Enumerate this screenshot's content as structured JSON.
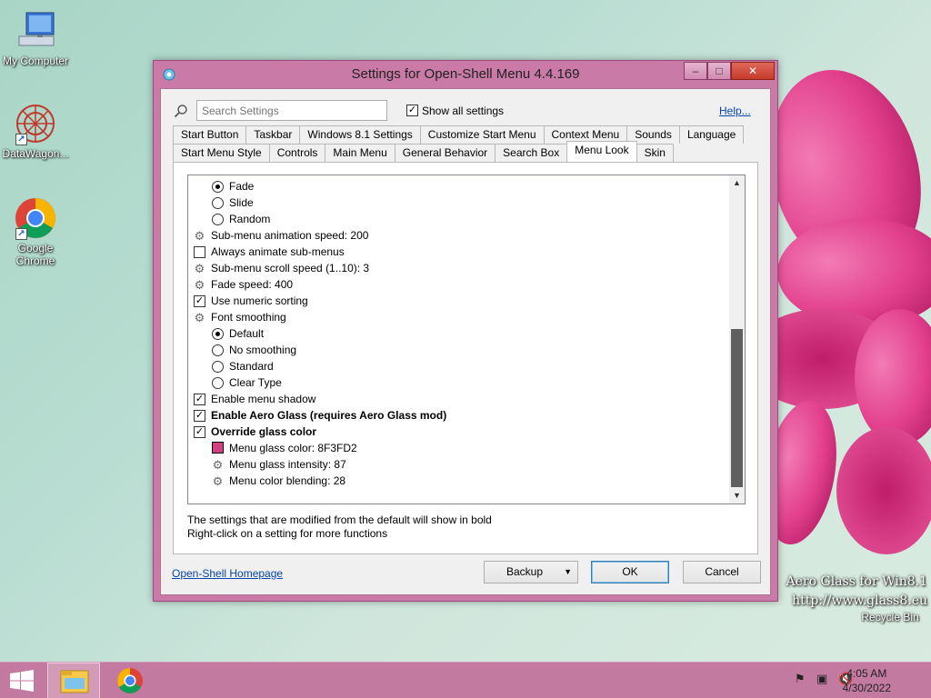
{
  "desktop": {
    "icons": [
      {
        "label": "My Computer",
        "icon": "computer-icon"
      },
      {
        "label": "DataWagon...",
        "icon": "app-icon"
      },
      {
        "label": "Google Chrome",
        "icon": "chrome-icon"
      }
    ],
    "recycle_bin": "Recycle Bin",
    "watermark_line1": "Aero Glass for Win8.1",
    "watermark_line2": "http://www.glass8.eu"
  },
  "window": {
    "title": "Settings for Open-Shell Menu 4.4.169",
    "controls": {
      "minimize": "–",
      "maximize": "□",
      "close": "✕"
    },
    "search_placeholder": "Search Settings",
    "show_all_label": "Show all settings",
    "show_all_checked": true,
    "help_label": "Help...",
    "tabs_row1": [
      "Start Button",
      "Taskbar",
      "Windows 8.1 Settings",
      "Customize Start Menu",
      "Context Menu",
      "Sounds",
      "Language"
    ],
    "tabs_row2": [
      "Start Menu Style",
      "Controls",
      "Main Menu",
      "General Behavior",
      "Search Box",
      "Menu Look",
      "Skin"
    ],
    "active_tab": "Menu Look",
    "settings": [
      {
        "kind": "radio",
        "checked": true,
        "indent": 1,
        "label": "Fade"
      },
      {
        "kind": "radio",
        "checked": false,
        "indent": 1,
        "label": "Slide"
      },
      {
        "kind": "radio",
        "checked": false,
        "indent": 1,
        "label": "Random"
      },
      {
        "kind": "gear",
        "indent": 0,
        "label": "Sub-menu animation speed: 200"
      },
      {
        "kind": "check",
        "checked": false,
        "indent": 0,
        "label": "Always animate sub-menus"
      },
      {
        "kind": "gear",
        "indent": 0,
        "label": "Sub-menu scroll speed (1..10): 3"
      },
      {
        "kind": "gear",
        "indent": 0,
        "label": "Fade speed: 400"
      },
      {
        "kind": "check",
        "checked": true,
        "indent": 0,
        "label": "Use numeric sorting"
      },
      {
        "kind": "gear",
        "indent": 0,
        "label": "Font smoothing"
      },
      {
        "kind": "radio",
        "checked": true,
        "indent": 1,
        "label": "Default"
      },
      {
        "kind": "radio",
        "checked": false,
        "indent": 1,
        "label": "No smoothing"
      },
      {
        "kind": "radio",
        "checked": false,
        "indent": 1,
        "label": "Standard"
      },
      {
        "kind": "radio",
        "checked": false,
        "indent": 1,
        "label": "Clear Type"
      },
      {
        "kind": "check",
        "checked": true,
        "indent": 0,
        "label": "Enable menu shadow"
      },
      {
        "kind": "check",
        "checked": true,
        "indent": 0,
        "bold": true,
        "label": "Enable Aero Glass (requires Aero Glass mod)"
      },
      {
        "kind": "check",
        "checked": true,
        "indent": 0,
        "bold": true,
        "label": "Override glass color"
      },
      {
        "kind": "swatch",
        "indent": 1,
        "color": "#D2407F",
        "label": "Menu glass color: 8F3FD2"
      },
      {
        "kind": "gear",
        "indent": 1,
        "label": "Menu glass intensity: 87"
      },
      {
        "kind": "gear",
        "indent": 1,
        "label": "Menu color blending: 28"
      }
    ],
    "hint_line1": "The settings that are modified from the default will show in bold",
    "hint_line2": "Right-click on a setting for more functions",
    "homepage_link": "Open-Shell Homepage",
    "backup_label": "Backup",
    "ok_label": "OK",
    "cancel_label": "Cancel"
  },
  "taskbar": {
    "time": "4:05 AM",
    "date": "4/30/2022",
    "color": "#C37AA1"
  }
}
